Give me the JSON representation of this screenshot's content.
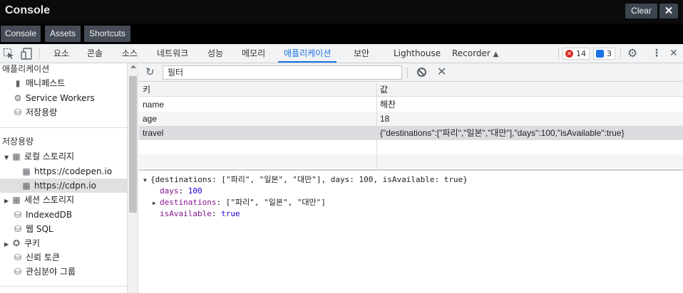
{
  "app": {
    "title": "Console",
    "clear_label": "Clear",
    "close_label": "✕"
  },
  "view_tabs": [
    "Console",
    "Assets",
    "Shortcuts"
  ],
  "devtools": {
    "tabs": [
      "요소",
      "콘솔",
      "소스",
      "네트워크",
      "성능",
      "메모리",
      "애플리케이션",
      "보안",
      "Lighthouse",
      "Recorder"
    ],
    "active_tab": "애플리케이션",
    "error_count": "14",
    "info_count": "3"
  },
  "sidebar": {
    "app_header": "애플리케이션",
    "app_items": [
      "매니페스트",
      "Service Workers",
      "저장용량"
    ],
    "storage_header": "저장용량",
    "local_storage": "로컬 스토리지",
    "local_items": [
      "https://codepen.io",
      "https://cdpn.io"
    ],
    "session_storage": "세션 스토리지",
    "indexeddb": "IndexedDB",
    "websql": "웹 SQL",
    "cookies": "쿠키",
    "trust_tokens": "신뢰 토큰",
    "interest_groups": "관심분야 그룹"
  },
  "toolbar": {
    "filter_placeholder": "필터"
  },
  "table": {
    "headers": {
      "key": "키",
      "value": "값"
    },
    "rows": [
      {
        "key": "name",
        "value": "해찬"
      },
      {
        "key": "age",
        "value": "18"
      },
      {
        "key": "travel",
        "value": "{\"destinations\":[\"파리\",\"일본\",\"대만\"],\"days\":100,\"isAvailable\":true}"
      }
    ]
  },
  "preview": {
    "summary": "{destinations: [\"파리\", \"일본\", \"대만\"], days: 100, isAvailable: true}",
    "days_key": "days",
    "days_value": "100",
    "destinations_key": "destinations",
    "destinations_value": "[\"파리\", \"일본\", \"대만\"]",
    "available_key": "isAvailable",
    "available_value": "true"
  }
}
